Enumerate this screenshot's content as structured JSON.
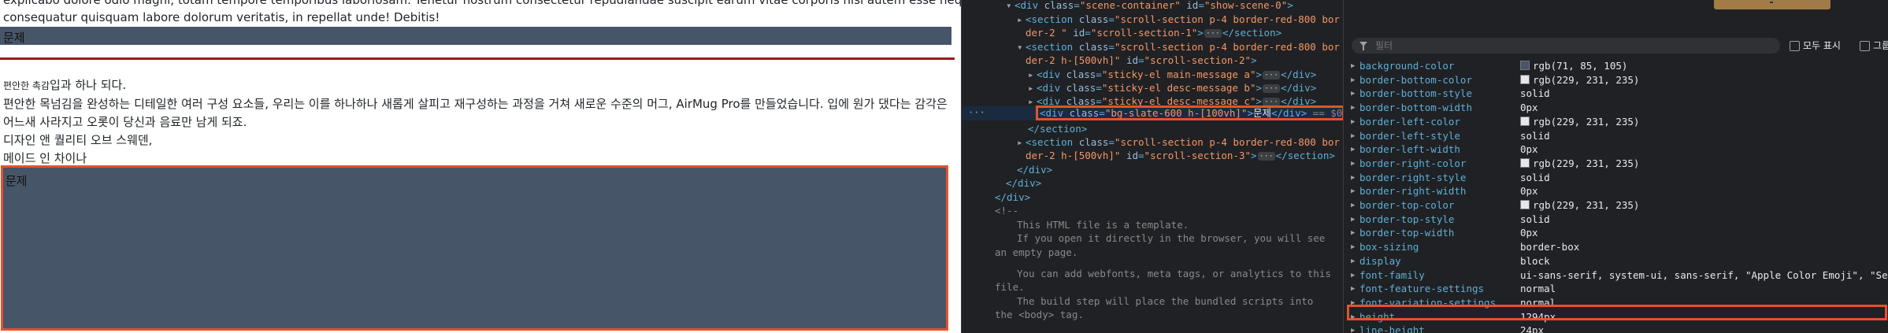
{
  "page": {
    "text_top_1": "explicabo dolore odio magni, totam tempore temporibus laboriosam. Tenetur nostrum consectetur repudiandae suscipit earum vitae corporis nisi autem esse neque",
    "text_top_2": "consequatur quisquam labore dolorum veritatis, in repellat unde! Debitis!",
    "bar_label": "문제",
    "small_label": "편안한 촉감",
    "heading_rest": "입과 하나 되다.",
    "para_1": "편안한 목넘김을 완성하는 디테일한 여러 구성 요소들, 우리는 이를 하나하나 새롭게 살피고 재구성하는 과정을 거쳐 새로운 수준의 머그, AirMug Pro를 만들었습니다. 입에 원가 댔다는 감각은",
    "para_2": "어느새 사라지고 오롯이 당신과 음료만 남게 되죠.",
    "para_3": "디자인 앤 퀄리티 오브 스웨덴,",
    "para_4": "메이드 인 차이나",
    "box_label": "문제",
    "colors": {
      "slate": "#475569",
      "red_rule": "#991b1b",
      "highlight": "#e4522b"
    }
  },
  "tree": {
    "l1_tag": "div",
    "l1_attr_class": "class",
    "l1_val_class": "\"scene-container\"",
    "l1_attr_id": "id",
    "l1_val_id": "\"show-scene-0\"",
    "l2_tag": "section",
    "l2_attr": "class",
    "l2_val": "\"scroll-section p-4 border-red-800 bor",
    "l2_val_b": "der-2 \"",
    "l2_attr_id": "id",
    "l2_val_id": "\"scroll-section-1\"",
    "l2_close": "</section>",
    "l3_tag": "section",
    "l3_attr": "class",
    "l3_val": "\"scroll-section p-4 border-red-800 bor",
    "l3_val_b": "der-2 h-[500vh]\"",
    "l3_attr_id": "id",
    "l3_val_id": "\"scroll-section-2\"",
    "l4_tag": "div",
    "l4_attr": "class",
    "l4_val": "\"sticky-el main-message a\"",
    "l4_close": "</div>",
    "l5_tag": "div",
    "l5_attr": "class",
    "l5_val": "\"sticky-el desc-message b\"",
    "l5_close": "</div>",
    "l6_tag": "div",
    "l6_attr": "class",
    "l6_val": "\"sticky-el desc-message c\"",
    "l6_close": "</div>",
    "l7_tag": "div",
    "l7_attr": "class",
    "l7_val": "\"bg-slate-600 h-[100vh]\"",
    "l7_text": "문제",
    "l7_close": "</div>",
    "l7_eq": "== $0",
    "l8_close": "</section>",
    "l9_tag": "section",
    "l9_attr": "class",
    "l9_val": "\"scroll-section p-4 border-red-800 bor",
    "l9_val_b": "der-2 h-[500vh]\"",
    "l9_attr_id": "id",
    "l9_val_id": "\"scroll-section-3\"",
    "l9_close": "</section>",
    "l10_close": "</div>",
    "l11_close": "</div>",
    "l12_close": "</div>",
    "comment_open": "<!--",
    "c1": "This HTML file is a template.",
    "c2": "If you open it directly in the browser, you will see",
    "c3": "an empty page.",
    "c4": "You can add webfonts, meta tags, or analytics to this",
    "c5": "file.",
    "c6": "The build step will place the bundled scripts into",
    "c7": "the <body> tag."
  },
  "styles": {
    "filter_placeholder": "필터",
    "show_all_label": "모두 표시",
    "group_label": "그룹",
    "rows": [
      {
        "name": "background-color",
        "value": "rgb(71, 85, 105)",
        "swatch": "#475569"
      },
      {
        "name": "border-bottom-color",
        "value": "rgb(229, 231, 235)",
        "swatch": "#e5e7eb"
      },
      {
        "name": "border-bottom-style",
        "value": "solid",
        "swatch": ""
      },
      {
        "name": "border-bottom-width",
        "value": "0px",
        "swatch": ""
      },
      {
        "name": "border-left-color",
        "value": "rgb(229, 231, 235)",
        "swatch": "#e5e7eb"
      },
      {
        "name": "border-left-style",
        "value": "solid",
        "swatch": ""
      },
      {
        "name": "border-left-width",
        "value": "0px",
        "swatch": ""
      },
      {
        "name": "border-right-color",
        "value": "rgb(229, 231, 235)",
        "swatch": "#e5e7eb"
      },
      {
        "name": "border-right-style",
        "value": "solid",
        "swatch": ""
      },
      {
        "name": "border-right-width",
        "value": "0px",
        "swatch": ""
      },
      {
        "name": "border-top-color",
        "value": "rgb(229, 231, 235)",
        "swatch": "#e5e7eb"
      },
      {
        "name": "border-top-style",
        "value": "solid",
        "swatch": ""
      },
      {
        "name": "border-top-width",
        "value": "0px",
        "swatch": ""
      },
      {
        "name": "box-sizing",
        "value": "border-box",
        "swatch": ""
      },
      {
        "name": "display",
        "value": "block",
        "swatch": ""
      },
      {
        "name": "font-family",
        "value": "ui-sans-serif, system-ui, sans-serif, \"Apple Color Emoji\", \"Segoe",
        "swatch": ""
      },
      {
        "name": "font-feature-settings",
        "value": "normal",
        "swatch": ""
      },
      {
        "name": "font-variation-settings",
        "value": "normal",
        "swatch": ""
      },
      {
        "name": "height",
        "value": "1294px",
        "swatch": ""
      },
      {
        "name": "line-height",
        "value": "24px",
        "swatch": ""
      }
    ]
  }
}
